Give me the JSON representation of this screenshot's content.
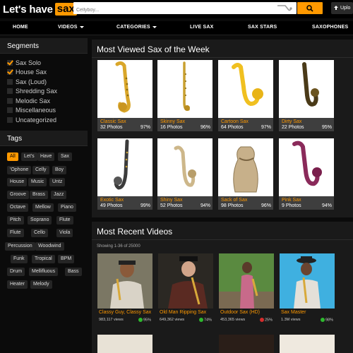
{
  "header": {
    "logo_text": "Let's have",
    "logo_badge": "sax",
    "search_placeholder": "Cellyboy...",
    "upload_label": "Uplo",
    "icons": {
      "search": "search-icon",
      "upload": "upload-icon",
      "search_decor": "saxophone-icon"
    },
    "accent": "#ff9900"
  },
  "nav": {
    "home": "HOME",
    "videos": "VIDEOS",
    "categories": "CATEGORIES",
    "live_sax": "LIVE SAX",
    "sax_stars": "SAX STARS",
    "saxophones": "SAXOPHONES"
  },
  "sidebar": {
    "segments_title": "Segments",
    "segments": [
      {
        "label": "Sax Solo",
        "checked": true
      },
      {
        "label": "House Sax",
        "checked": true
      },
      {
        "label": "Sax (Loud)",
        "checked": false
      },
      {
        "label": "Shredding Sax",
        "checked": false
      },
      {
        "label": "Melodic Sax",
        "checked": false
      },
      {
        "label": "Miscellaneous",
        "checked": false
      },
      {
        "label": "Uncategorized",
        "checked": false
      }
    ],
    "tags_title": "Tags",
    "tags": [
      "All",
      "Let's",
      "Have",
      "Sax",
      "'Ophone",
      "Celly",
      "Boy",
      "House",
      "Music",
      "Untz",
      "Groove",
      "Brass",
      "Jazz",
      "Octave",
      "Mellow",
      "Piano",
      "Pitch",
      "Soprano",
      "Flute",
      "Flute",
      "Cello",
      "Viola",
      "Percussion",
      "Woodwind",
      "Funk",
      "Tropical",
      "BPM",
      "Drum",
      "Mellifluous",
      "Bass",
      "Heater",
      "Melody"
    ]
  },
  "most_viewed": {
    "title": "Most Viewed Sax of the Week",
    "items": [
      {
        "name": "Classic Sax",
        "count": "32 Photos",
        "pct": "97%"
      },
      {
        "name": "Skinny Sax",
        "count": "16 Photos",
        "pct": "96%"
      },
      {
        "name": "Cartoon Sax",
        "count": "64 Photos",
        "pct": "97%"
      },
      {
        "name": "Dirty Sax",
        "count": "22 Photos",
        "pct": "95%"
      },
      {
        "name": "Exotic Sax",
        "count": "49 Photos",
        "pct": "99%"
      },
      {
        "name": "Shiny Sax",
        "count": "52 Photos",
        "pct": "94%"
      },
      {
        "name": "Sack of Sax",
        "count": "98 Photos",
        "pct": "96%"
      },
      {
        "name": "Pink Sax",
        "count": "9 Photos",
        "pct": "94%"
      }
    ]
  },
  "recent": {
    "title": "Most Recent Videos",
    "showing": "Showing 1-36 of 25000",
    "videos": [
      {
        "title": "Classy Guy, Classy Sax",
        "views": "983,117 views",
        "rating": "95%",
        "rating_color": "#2eb82e"
      },
      {
        "title": "Old Man Ripping Sax",
        "views": "649,362 views",
        "rating": "74%",
        "rating_color": "#2eb82e"
      },
      {
        "title": "Outdoor Sax (HD)",
        "views": "453,365 views",
        "rating": "25%",
        "rating_color": "#d62d2d"
      },
      {
        "title": "Sax Master",
        "views": "1.3M views",
        "rating": "98%",
        "rating_color": "#2eb82e"
      }
    ]
  }
}
